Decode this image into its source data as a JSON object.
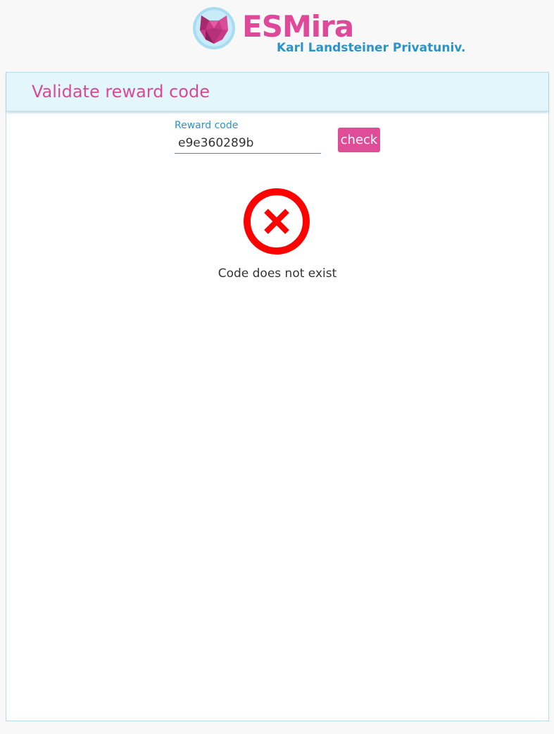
{
  "brand": {
    "title": "ESMira",
    "subtitle": "Karl Landsteiner Privatuniv.",
    "logo_icon": "esmira-gem-logo-icon",
    "primary_color": "#e0489a",
    "secondary_color": "#2c93c8"
  },
  "page": {
    "title": "Validate reward code"
  },
  "form": {
    "label": "Reward code",
    "value": "e9e360289b",
    "button_label": "check"
  },
  "result": {
    "icon": "error-x-circle-icon",
    "icon_color": "#ff0000",
    "message": "Code does not exist"
  }
}
